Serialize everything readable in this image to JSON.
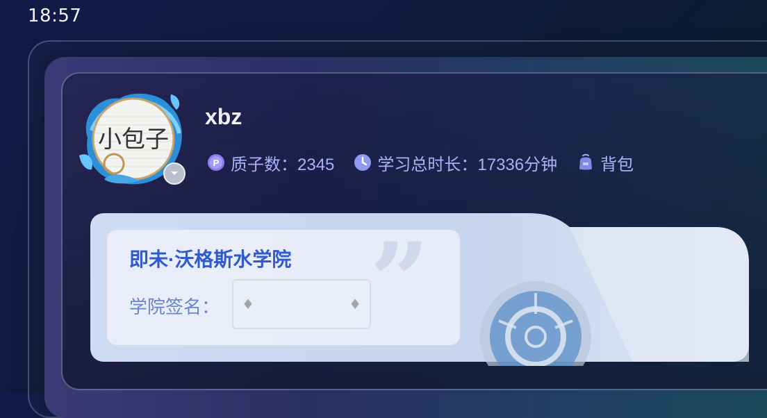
{
  "status_bar": {
    "time": "18:57"
  },
  "profile": {
    "username": "xbz",
    "avatar_text": "小包子",
    "stats": [
      {
        "icon": "proton-coin-icon",
        "label": "质子数：2345"
      },
      {
        "icon": "clock-icon",
        "label": "学习总时长：17336分钟"
      },
      {
        "icon": "backpack-icon",
        "label": "背包"
      }
    ]
  },
  "college_card": {
    "name": "即未·沃格斯水学院",
    "signature_label": "学院签名：",
    "signature_select": {
      "left_symbol": "♦",
      "right_symbol": "♦"
    }
  },
  "colors": {
    "accent_blue": "#2f5bcf",
    "stat_text": "#aab1f7",
    "label_text": "#6a86c8"
  }
}
